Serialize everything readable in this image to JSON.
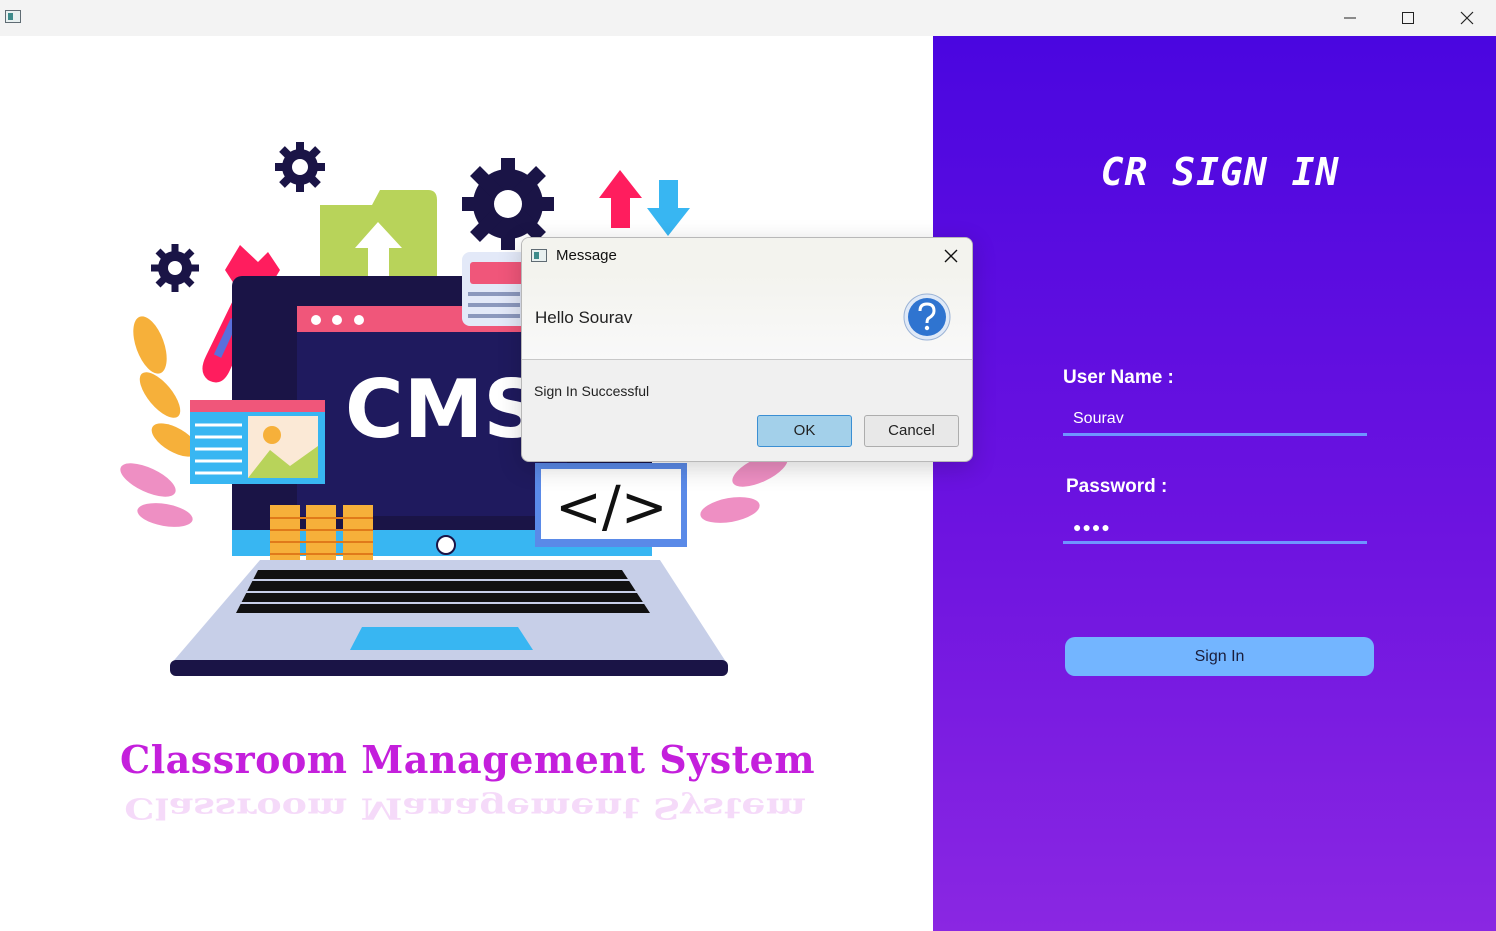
{
  "window": {
    "controls": {
      "minimize_icon": "minimize-icon",
      "maximize_icon": "maximize-icon",
      "close_icon": "close-icon"
    }
  },
  "left": {
    "screen_text": "CMS",
    "caption": "Classroom Management System"
  },
  "signin": {
    "title": "CR SIGN IN",
    "username_label": "User Name :",
    "username_value": "Sourav",
    "password_label": "Password :",
    "password_value": "●●●●",
    "button_label": "Sign In"
  },
  "dialog": {
    "title": "Message",
    "header_text": "Hello Sourav",
    "message": "Sign In Successful",
    "ok_label": "OK",
    "cancel_label": "Cancel",
    "icon": "question-icon"
  },
  "colors": {
    "panel_top": "#4a06e0",
    "panel_bottom": "#8a27e2",
    "accent_button": "#73b5ff",
    "caption": "#c41fdc"
  }
}
